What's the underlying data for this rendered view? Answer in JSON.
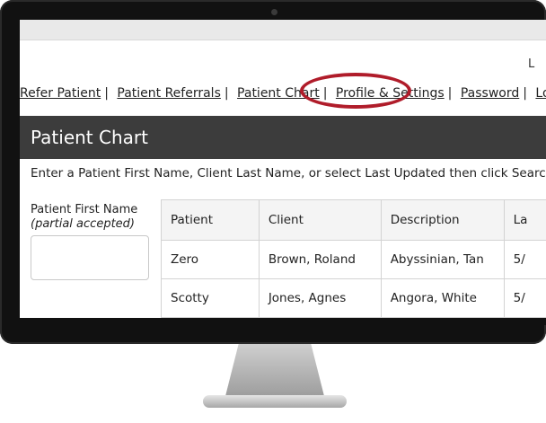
{
  "header": {
    "corner_text": "L"
  },
  "nav": {
    "items": [
      {
        "label": "Refer Patient"
      },
      {
        "label": "Patient Referrals"
      },
      {
        "label": "Patient Chart"
      },
      {
        "label": "Profile & Settings"
      },
      {
        "label": "Password"
      },
      {
        "label": "Log Out"
      }
    ],
    "separator": "|",
    "highlight_color": "#b01c2a"
  },
  "panel": {
    "title": "Patient Chart",
    "instructions": "Enter a Patient First Name, Client Last Name, or select Last Updated then click Search."
  },
  "filter": {
    "label": "Patient First Name",
    "hint": "(partial accepted)",
    "value": ""
  },
  "table": {
    "headers": [
      "Patient",
      "Client",
      "Description",
      "La"
    ],
    "rows": [
      [
        "Zero",
        "Brown, Roland",
        "Abyssinian, Tan",
        "5/"
      ],
      [
        "Scotty",
        "Jones, Agnes",
        "Angora, White",
        "5/"
      ]
    ]
  }
}
